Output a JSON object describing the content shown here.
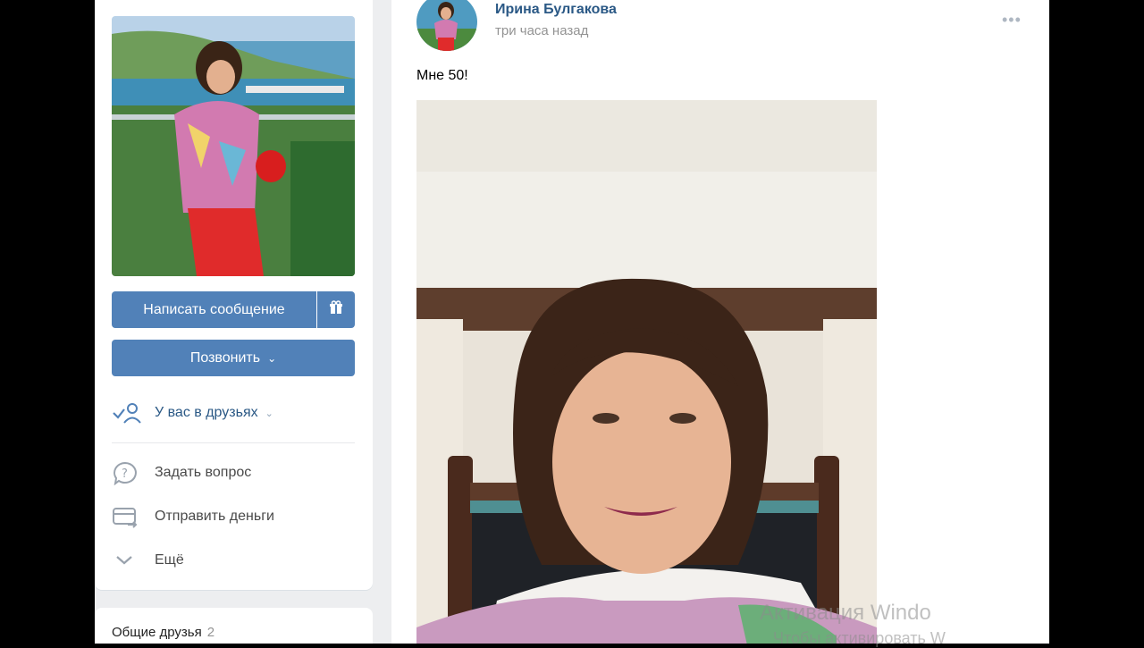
{
  "left": {
    "message_button": "Написать сообщение",
    "gift_icon": "gift-icon",
    "call_button": "Позвонить",
    "friends_status": "У вас в друзьях",
    "menu": [
      {
        "label": "Задать вопрос",
        "icon": "question-bubble-icon"
      },
      {
        "label": "Отправить деньги",
        "icon": "money-transfer-icon"
      },
      {
        "label": "Ещё",
        "icon": "chevron-down-icon"
      }
    ],
    "mutual_friends": {
      "label": "Общие друзья",
      "count": "2"
    }
  },
  "post": {
    "author": "Ирина Булгакова",
    "time": "три часа назад",
    "text": "Мне 50!"
  },
  "watermark": {
    "line1": "Активация Windo",
    "line2": "Чтобы активировать W"
  },
  "colors": {
    "accent": "#5181b8",
    "link": "#2a5885",
    "background": "#edeef0"
  }
}
